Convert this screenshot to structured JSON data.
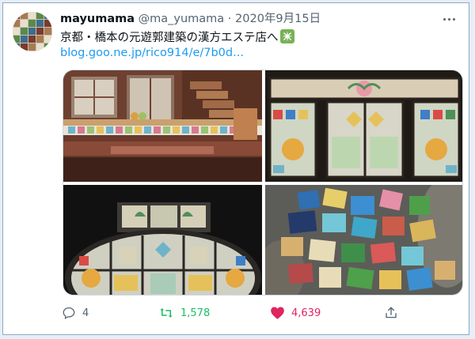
{
  "tweet": {
    "display_name": "mayumama",
    "handle": "@ma_yumama",
    "separator": "·",
    "date": "2020年9月15日",
    "text": "京都・橋本の元遊郭建築の漢方エステ店へ",
    "link": "blog.goo.ne.jp/rico914/e/7b0d..."
  },
  "actions": {
    "reply_count": "4",
    "retweet_count": "1,578",
    "like_count": "4,639"
  },
  "colors": {
    "link": "#1d9bf0",
    "retweet": "#17bf63",
    "like": "#e0245e",
    "muted": "#536471"
  },
  "icons": [
    "more-options-icon",
    "sparkle-emoji-icon",
    "reply-icon",
    "retweet-icon",
    "like-heart-icon",
    "share-icon"
  ]
}
